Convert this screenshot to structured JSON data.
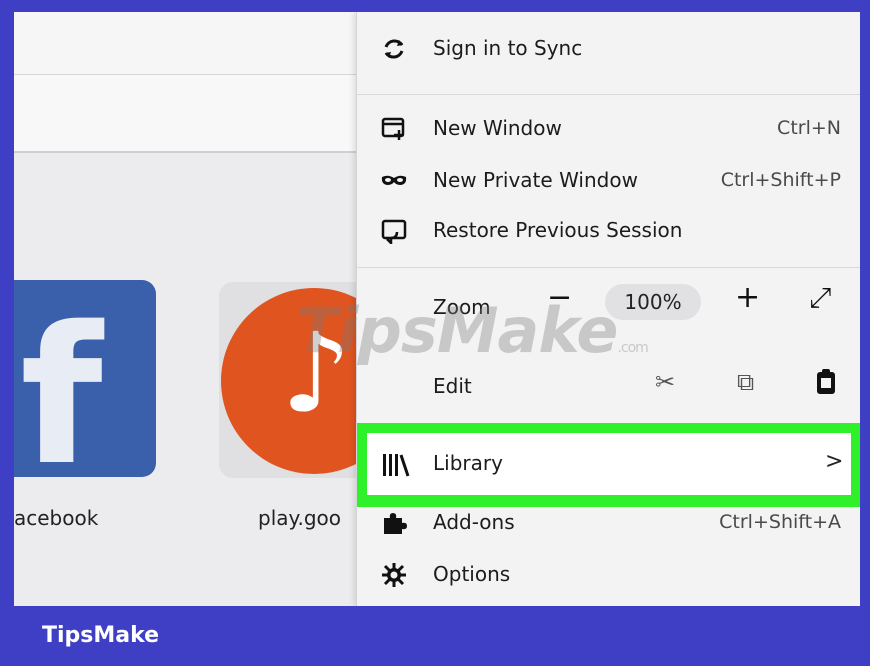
{
  "menu": {
    "sign_in": {
      "label": "Sign in to Sync",
      "icon": "sync-icon"
    },
    "new_window": {
      "label": "New Window",
      "shortcut": "Ctrl+N",
      "icon": "new-window-icon"
    },
    "new_private": {
      "label": "New Private Window",
      "shortcut": "Ctrl+Shift+P",
      "icon": "private-mask-icon"
    },
    "restore": {
      "label": "Restore Previous Session",
      "icon": "restore-session-icon"
    },
    "zoom": {
      "label": "Zoom",
      "minus": "−",
      "value": "100%",
      "plus": "+",
      "fullscreen": "⤢"
    },
    "edit": {
      "label": "Edit",
      "cut": "✂",
      "copy": "⧉",
      "paste": "📋"
    },
    "library": {
      "label": "Library",
      "arrow": ">",
      "icon": "library-icon"
    },
    "addons": {
      "label": "Add-ons",
      "shortcut": "Ctrl+Shift+A",
      "icon": "puzzle-icon"
    },
    "options": {
      "label": "Options",
      "icon": "gear-icon"
    }
  },
  "tiles": [
    {
      "label": "acebook",
      "icon": "facebook-icon",
      "glyph": "f"
    },
    {
      "label": "play.goo",
      "icon": "music-note-icon",
      "glyph": "♪"
    }
  ],
  "watermark": {
    "text": "TipsMake",
    "suffix": ".com"
  },
  "footer": {
    "brand": "TipsMake"
  },
  "colors": {
    "frame": "#3f3fc6",
    "highlight": "#2ef12a",
    "facebook": "#3a5fab",
    "play": "#e0541f"
  }
}
